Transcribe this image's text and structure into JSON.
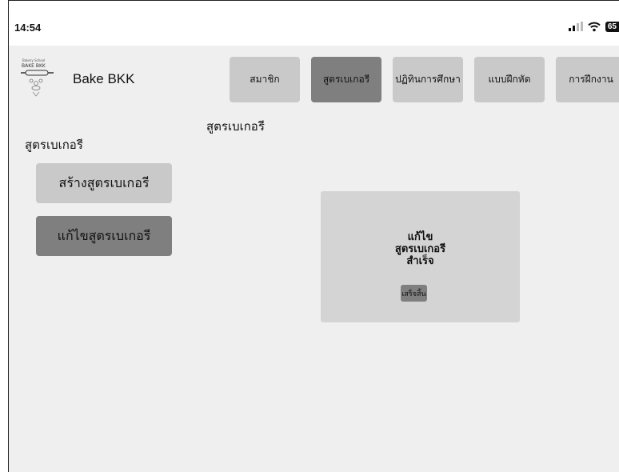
{
  "status_bar": {
    "time": "14:54",
    "battery": "65"
  },
  "brand": {
    "name": "Bake BKK",
    "logo_text": "BAKE BKK"
  },
  "nav": {
    "items": [
      {
        "label": "สมาชิก"
      },
      {
        "label": "สูตรเบเกอรี"
      },
      {
        "label": "ปฏิทินการศึกษา"
      },
      {
        "label": "แบบฝึกหัด"
      },
      {
        "label": "การฝึกงาน"
      }
    ],
    "active_index": 1
  },
  "page": {
    "title": "สูตรเบเกอรี"
  },
  "sidebar": {
    "title": "สูตรเบเกอรี",
    "create_label": "สร้างสูตรเบเกอรี",
    "edit_label": "แก้ไขสูตรเบเกอรี"
  },
  "dialog": {
    "line1": "แก้ไข",
    "line2": "สูตรเบเกอรี",
    "line3": "สำเร็จ",
    "button": "เสร็จสิ้น"
  },
  "colors": {
    "background": "#efefef",
    "button_light": "#c9c9c9",
    "button_dark": "#7f7f7f",
    "dialog": "#d4d4d4"
  }
}
